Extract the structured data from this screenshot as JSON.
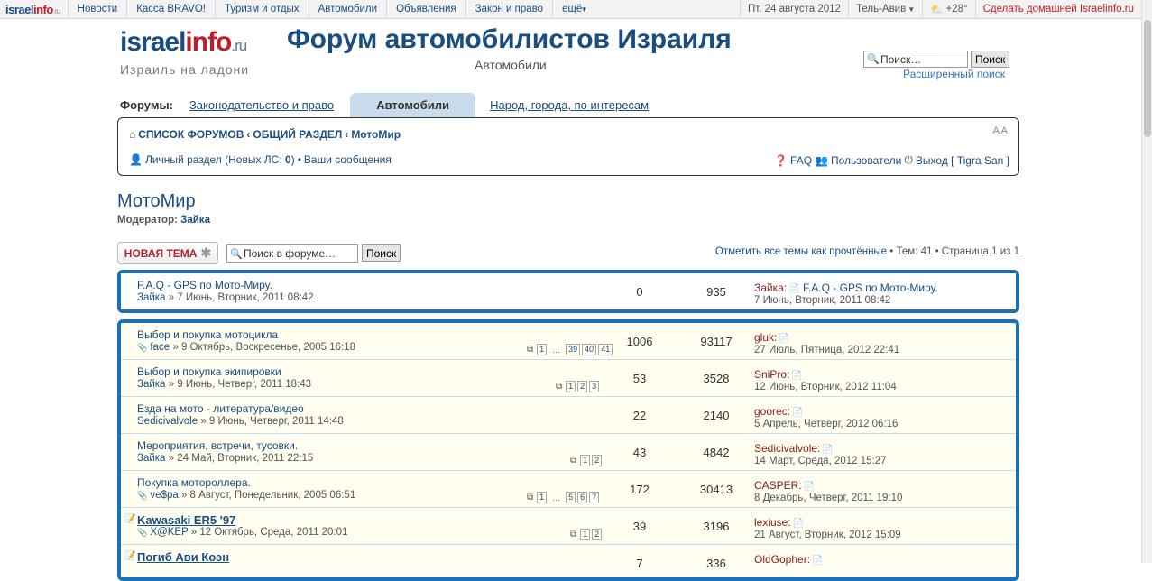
{
  "topbar": {
    "logo_main": "israel",
    "logo_accent": "info",
    "logo_tld": ".ru",
    "nav": [
      "Новости",
      "Касса BRAVO!",
      "Туризм и отдых",
      "Автомобили",
      "Объявления",
      "Закон и право",
      "ещё"
    ],
    "date": "Пт. 24 августа 2012",
    "city": "Тель-Авив",
    "temp": "+28°",
    "make_home": "Сделать домашней Israelinfo.ru"
  },
  "brand": {
    "name_main": "israel",
    "name_accent": "info",
    "tld": ".ru",
    "tagline": "Израиль на ладони"
  },
  "header": {
    "title": "Форум автомобилистов Израиля",
    "subtitle": "Автомобили",
    "search_placeholder": "Поиск…",
    "search_button": "Поиск",
    "advanced": "Расширенный поиск"
  },
  "tabs": {
    "label": "Форумы:",
    "items": [
      "Законодательство и право",
      "Автомобили",
      "Народ, города, по интересам"
    ],
    "active": "Автомобили"
  },
  "navbar": {
    "crumb_home": "СПИСОК ФОРУМОВ",
    "crumb_sep": "‹",
    "crumb_1": "ОБЩИЙ РАЗДЕЛ",
    "crumb_2": "МотоМир",
    "font_size": "A A",
    "personal": "Личный раздел (Новых ЛС: ",
    "new_pm": "0",
    "personal_end": ")",
    "bullet": "•",
    "my_posts": "Ваши сообщения",
    "faq": "FAQ",
    "users": "Пользователи",
    "logout": "Выход [ Tigra San ]"
  },
  "forum": {
    "title": "МотоМир",
    "moderator_label": "Модератор:",
    "moderator": "Зайка",
    "new_topic": "НОВАЯ ТЕМА",
    "search_placeholder": "Поиск в форуме…",
    "search_button": "Поиск",
    "mark_read": "Отметить все темы как прочтённые",
    "topics_info": "• Тем: 41 • Страница 1 из 1"
  },
  "announcements": [
    {
      "title": "F.A.Q - GPS по Мото-Миру.",
      "author": "Зайка",
      "date": "» 7 Июнь, Вторник, 2011 08:42",
      "replies": "0",
      "views": "935",
      "last_author": "Зайка:",
      "last_title": "F.A.Q - GPS по Мото-Миру.",
      "last_date": "7 Июнь, Вторник, 2011 08:42"
    }
  ],
  "topics": [
    {
      "title": "Выбор и покупка мотоцикла",
      "attach": true,
      "author": "face",
      "date": "» 9 Октябрь, Воскресенье, 2005 16:18",
      "pages": [
        "1",
        "…",
        "39",
        "40",
        "41"
      ],
      "replies": "1006",
      "views": "93117",
      "last_author": "gluk:",
      "last_date": "27 Июль, Пятница, 2012 22:41"
    },
    {
      "title": "Выбор и покупка экипировки",
      "attach": false,
      "author": "Зайка",
      "date": "» 9 Июнь, Четверг, 2011 18:43",
      "pages": [
        "1",
        "2",
        "3"
      ],
      "replies": "53",
      "views": "3528",
      "last_author": "SniPro:",
      "last_date": "12 Июнь, Вторник, 2012 11:04"
    },
    {
      "title": "Езда на мото - литература/видео",
      "attach": false,
      "author": "Sedicivalvole",
      "date": "» 9 Июнь, Четверг, 2011 14:48",
      "pages": [],
      "replies": "22",
      "views": "2140",
      "last_author": "goorec:",
      "last_date": "5 Апрель, Четверг, 2012 06:16"
    },
    {
      "title": "Мероприятия, встречи, тусовки.",
      "attach": false,
      "author": "Зайка",
      "date": "» 24 Май, Вторник, 2011 22:15",
      "pages": [
        "1",
        "2"
      ],
      "replies": "43",
      "views": "4842",
      "last_author": "Sedicivalvole:",
      "last_date": "14 Март, Среда, 2012 15:27"
    },
    {
      "title": "Покупка мотороллера.",
      "attach": true,
      "author": "ve$pa",
      "date": "» 8 Август, Понедельник, 2005 06:51",
      "pages": [
        "1",
        "…",
        "5",
        "6",
        "7"
      ],
      "replies": "172",
      "views": "30413",
      "last_author": "CASPER:",
      "last_date": "8 Декабрь, Четверг, 2011 19:10"
    },
    {
      "title": "Kawasaki ER5 '97",
      "bold": true,
      "attach": true,
      "author": "X@KEP",
      "date": "» 12 Октябрь, Среда, 2011 20:01",
      "pages": [
        "1",
        "2"
      ],
      "replies": "39",
      "views": "3196",
      "last_author": "lexiuse:",
      "last_date": "21 Август, Вторник, 2012 15:09"
    },
    {
      "title": "Погиб Ави Коэн",
      "bold": true,
      "attach": false,
      "author": "",
      "date": "",
      "pages": [],
      "replies": "7",
      "views": "336",
      "last_author": "OldGopher:",
      "last_date": ""
    }
  ]
}
